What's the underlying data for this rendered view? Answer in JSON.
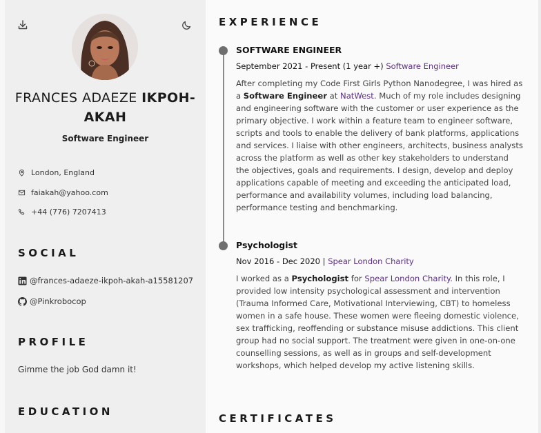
{
  "sidebar": {
    "name_first": "FRANCES ADAEZE",
    "name_last": "IKPOH-AKAH",
    "role": "Software Engineer",
    "contacts": [
      {
        "icon": "location-pin-icon",
        "text": "London, England"
      },
      {
        "icon": "mail-icon",
        "text": "faiakah@yahoo.com"
      },
      {
        "icon": "phone-icon",
        "text": "+44 (776) 7207413"
      }
    ],
    "social_title": "SOCIAL",
    "social": [
      {
        "icon": "linkedin-icon",
        "text": "@frances-adaeze-ikpoh-akah-a15581207"
      },
      {
        "icon": "github-icon",
        "text": "@Pinkrobocop"
      }
    ],
    "profile_title": "PROFILE",
    "profile_text": "Gimme the job God damn it!",
    "education_title": "EDUCATION"
  },
  "main": {
    "experience_title": "EXPERIENCE",
    "jobs": [
      {
        "title": "SOFTWARE ENGINEER",
        "date_prefix": "September 2021 - Present (1 year +)",
        "date_link": "Software Engineer",
        "desc_1": "After completing my Code First Girls Python Nanodegree, I was hired as a ",
        "desc_bold": "Software Engineer",
        "desc_2": " at ",
        "desc_link": "NatWest",
        "desc_3": ". Much of my role includes designing and engineering software with the customer or user experience as the primary objective. I work within a feature team to engineer software, scripts and tools to enable the delivery of bank platforms, applications and services. I liaise with other engineers, architects, business analysts across the platform as well as other key stakeholders to understand the objectives, goals and requirements. I design, develop and deploy applications capable of meeting and exceeding the anticipated load, performance and availability volumes, including load balancing, performance testing and benchmarking."
      },
      {
        "title": "Psychologist",
        "date_prefix": "Nov 2016 - Dec 2020 |",
        "date_link": "Spear London Charity",
        "desc_1": "I worked as a ",
        "desc_bold": "Psychologist",
        "desc_2": " for ",
        "desc_link": "Spear London Charity",
        "desc_3": ". In this role, I provided low intensity psychological assessment and intervention (Trauma Informed Care, Motivational Interviewing, CBT) to homeless women in a safe house. These women were fleeing domestic violence, sex trafficking, reoffending or substance misuse addictions. This client group had no social support. The treatment were given in one-on-one counselling sessions, as well as in groups and self-development workshops, which helped develop my active listening skills."
      }
    ],
    "certificates_title": "CERTIFICATES"
  }
}
